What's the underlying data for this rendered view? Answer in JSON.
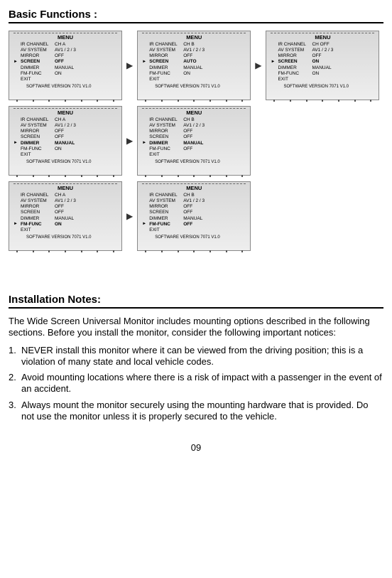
{
  "titles": {
    "basic": "Basic Functions :",
    "install": "Installation Notes:"
  },
  "menu_title": "MENU",
  "sw_version": "SOFTWARE VERSION 7071 V1.0",
  "keys": {
    "ir": "IR CHANNEL",
    "av": "AV SYSTEM",
    "mir": "MIRROR",
    "scr": "SCREEN",
    "dim": "DIMMER",
    "fm": "FM-FUNC",
    "exit": "EXIT"
  },
  "screens": [
    {
      "sel": "scr",
      "vals": {
        "ir": "CH   A",
        "av": "AV1 / 2 / 3",
        "mir": "OFF",
        "scr": "OFF",
        "dim": "MANUAL",
        "fm": "ON",
        "exit": ""
      }
    },
    {
      "sel": "scr",
      "vals": {
        "ir": "CH   B",
        "av": "AV1 / 2 / 3",
        "mir": "OFF",
        "scr": "AUTO",
        "dim": "MANUAL",
        "fm": "ON",
        "exit": ""
      }
    },
    {
      "sel": "scr",
      "vals": {
        "ir": "CH   OFF",
        "av": "AV1 / 2 / 3",
        "mir": "OFF",
        "scr": "ON",
        "dim": "MANUAL",
        "fm": "ON",
        "exit": ""
      }
    },
    {
      "sel": "dim",
      "vals": {
        "ir": "CH   A",
        "av": "AV1 / 2 / 3",
        "mir": "OFF",
        "scr": "OFF",
        "dim": "MANUAL",
        "fm": "ON",
        "exit": ""
      }
    },
    {
      "sel": "dim",
      "vals": {
        "ir": "CH   B",
        "av": "AV1 / 2 / 3",
        "mir": "OFF",
        "scr": "OFF",
        "dim": "MANUAL",
        "fm": "OFF",
        "exit": ""
      }
    },
    {
      "sel": "fm",
      "vals": {
        "ir": "CH   A",
        "av": "AV1 / 2 / 3",
        "mir": "OFF",
        "scr": "OFF",
        "dim": "MANUAL",
        "fm": "ON",
        "exit": ""
      }
    },
    {
      "sel": "fm",
      "vals": {
        "ir": "CH   B",
        "av": "AV1 / 2 / 3",
        "mir": "OFF",
        "scr": "OFF",
        "dim": "MANUAL",
        "fm": "OFF",
        "exit": ""
      }
    }
  ],
  "install_para": "The Wide Screen Universal Monitor includes mounting options described in the following sections. Before you install the monitor, consider the following important notices:",
  "install_items": [
    "NEVER install this monitor where it can be viewed from the driving position; this is a violation of many state and local vehicle codes.",
    "Avoid mounting locations where there is a risk of impact with a passenger in the event of an accident.",
    "Always mount the monitor securely using the mounting hardware that is provided. Do not use the monitor unless it is properly secured to the vehicle."
  ],
  "page_number": "09",
  "arrow": "▶"
}
